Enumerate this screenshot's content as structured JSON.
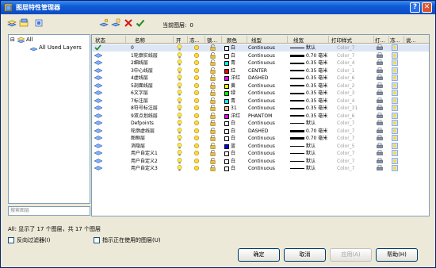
{
  "window": {
    "title": "图层特性管理器"
  },
  "toolbar": {
    "current_layer_label": "当前图层:",
    "current_layer_value": "0"
  },
  "tree": {
    "root_label": "All",
    "child_label": "All Used Layers",
    "search_placeholder": "搜索图层"
  },
  "columns": [
    "状态",
    "名称",
    "开",
    "冻...",
    "锁...",
    "颜色",
    "线型",
    "线宽",
    "打印样式",
    "打...",
    "冻...",
    "说..."
  ],
  "rows": [
    {
      "name": "0",
      "color_name": "白",
      "color": "#ffffff",
      "linetype": "Continuous",
      "lineweight": "默认",
      "plot_style": "Color_7",
      "selected": true
    },
    {
      "name": "1轮廓实线层",
      "color_name": "白",
      "color": "#ffffff",
      "linetype": "Continuous",
      "lineweight": "0.70 毫米",
      "plot_style": "Color_7"
    },
    {
      "name": "2细线层",
      "color_name": "青",
      "color": "#00ffff",
      "linetype": "Continuous",
      "lineweight": "0.35 毫米",
      "plot_style": "Color_4"
    },
    {
      "name": "3中心线层",
      "color_name": "红",
      "color": "#ff0000",
      "linetype": "CENTER",
      "lineweight": "0.35 毫米",
      "plot_style": "Color_1"
    },
    {
      "name": "4虚线层",
      "color_name": "洋红",
      "color": "#ff00ff",
      "linetype": "DASHED",
      "lineweight": "0.35 毫米",
      "plot_style": "Color_6"
    },
    {
      "name": "5剖面线层",
      "color_name": "黄",
      "color": "#ffff00",
      "linetype": "Continuous",
      "lineweight": "0.35 毫米",
      "plot_style": "Color_2"
    },
    {
      "name": "6文字层",
      "color_name": "绿",
      "color": "#00ff00",
      "linetype": "Continuous",
      "lineweight": "0.35 毫米",
      "plot_style": "Color_3"
    },
    {
      "name": "7标注层",
      "color_name": "青",
      "color": "#00ffff",
      "linetype": "Continuous",
      "lineweight": "0.35 毫米",
      "plot_style": "Color_4"
    },
    {
      "name": "8符号标注层",
      "color_name": "31",
      "color": "#ffbf7f",
      "linetype": "Continuous",
      "lineweight": "0.35 毫米",
      "plot_style": "Color_31"
    },
    {
      "name": "9双点划线层",
      "color_name": "洋红",
      "color": "#ff00ff",
      "linetype": "PHANTOM",
      "lineweight": "0.35 毫米",
      "plot_style": "Color_6"
    },
    {
      "name": "Defpoints",
      "color_name": "白",
      "color": "#ffffff",
      "linetype": "Continuous",
      "lineweight": "默认",
      "plot_style": "Color_7"
    },
    {
      "name": "轮廓虚线层",
      "color_name": "白",
      "color": "#ffffff",
      "linetype": "DASHED",
      "lineweight": "0.70 毫米",
      "plot_style": "Color_7"
    },
    {
      "name": "图框层",
      "color_name": "白",
      "color": "#ffffff",
      "linetype": "Continuous",
      "lineweight": "0.70 毫米",
      "plot_style": "Color_7"
    },
    {
      "name": "消隐层",
      "color_name": "蓝",
      "color": "#0000ff",
      "linetype": "Continuous",
      "lineweight": "默认",
      "plot_style": "Color_5"
    },
    {
      "name": "用户自定义1",
      "color_name": "白",
      "color": "#ffffff",
      "linetype": "Continuous",
      "lineweight": "默认",
      "plot_style": "Color_7"
    },
    {
      "name": "用户自定义2",
      "color_name": "白",
      "color": "#ffffff",
      "linetype": "Continuous",
      "lineweight": "默认",
      "plot_style": "Color_7"
    },
    {
      "name": "用户自定义3",
      "color_name": "白",
      "color": "#ffffff",
      "linetype": "Continuous",
      "lineweight": "默认",
      "plot_style": "Color_7"
    }
  ],
  "status_text": "All: 显示了 17 个图层，共 17 个图层",
  "options": {
    "invert_filter": "反向过滤器(I)",
    "indicate_in_use": "指示正在使用的图层(U)"
  },
  "buttons": {
    "ok": "确定",
    "cancel": "取消",
    "apply": "应用(A)",
    "help": "帮助(H)"
  }
}
